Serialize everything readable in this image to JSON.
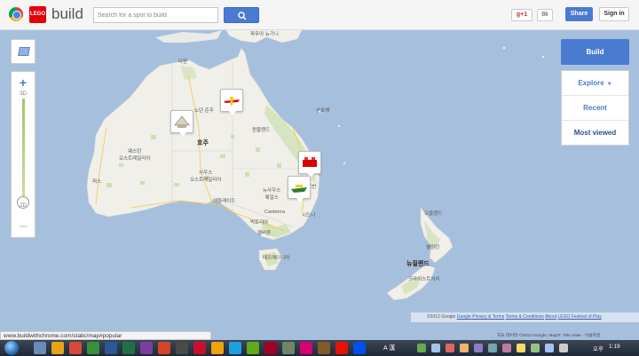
{
  "header": {
    "brand": "build",
    "lego_label": "LEGO",
    "search_placeholder": "Search for a spot to build",
    "gplus_label": "g+1",
    "gplus_count": "8k",
    "share_label": "Share",
    "signin_label": "Sign in"
  },
  "side_panel": {
    "build_label": "Build",
    "explore_label": "Explore",
    "recent_label": "Recent",
    "most_viewed_label": "Most viewed"
  },
  "zoom": {
    "label_3d": "3D",
    "label_2d": "2D"
  },
  "map_labels": {
    "png": "파푸아\n뉴기니",
    "darwin": "다윈",
    "australia": "호주",
    "wa": "웨스턴\n오스트레일리아",
    "sa": "사우스\n오스트레일리아",
    "qld": "퀸즐랜드",
    "nsw": "뉴사우스\n웨일스",
    "perth": "퍼스",
    "adelaide": "애들레이드",
    "canberra": "Canberra",
    "melbourne": "멜버른",
    "tasmania": "태즈메이니아",
    "victoria": "빅토리아",
    "nt": "노던 준주",
    "nz": "뉴질랜드",
    "auckland": "오클랜드",
    "wellington": "웰링턴",
    "christchurch": "크라이스트처치",
    "brisbane": "브리즈번",
    "sydney": "시드니",
    "coral_sea": "산호해"
  },
  "footer": {
    "copyright": "©2012 Google",
    "privacy": "Google Privacy & Terms",
    "terms": "Terms & Conditions",
    "about": "About",
    "festival": "LEGO Festival of Play",
    "map_copyright": "지도 데이터 ©2012 Google, MapIT, Tele Atlas - 이용약관",
    "status_url": "www.buildwithchrome.com/static/map#popular"
  },
  "taskbar": {
    "ampm": "오후",
    "time": "1:19",
    "ime_label": "A 漢"
  },
  "colors": {
    "ocean": "#a6bfdd",
    "land": "#f0efe9",
    "accent": "#4a7bd0",
    "forest": "#cde0b1"
  }
}
